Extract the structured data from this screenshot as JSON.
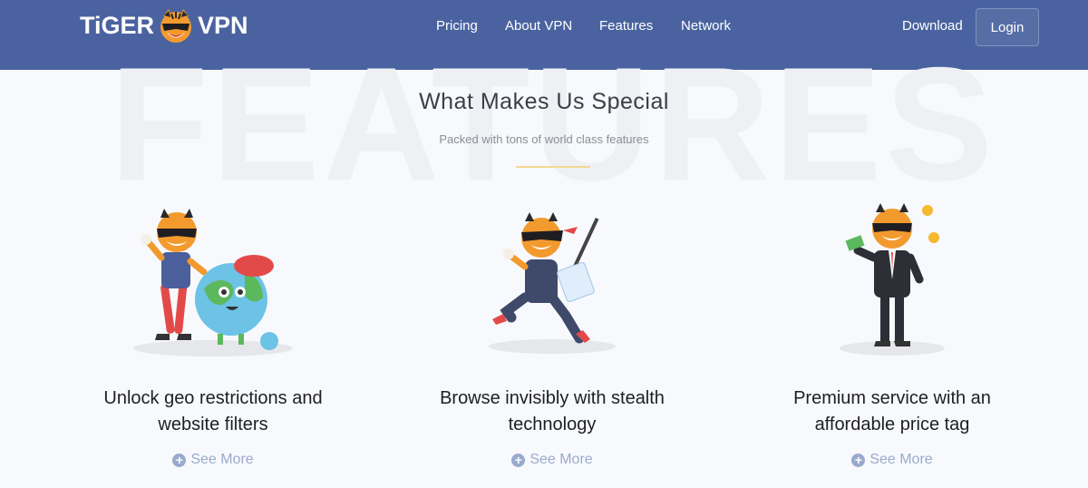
{
  "brand": {
    "name_left": "TiGER",
    "name_right": "VPN"
  },
  "nav": {
    "links": [
      "Pricing",
      "About VPN",
      "Features",
      "Network"
    ],
    "download": "Download",
    "login": "Login"
  },
  "section": {
    "watermark": "FEATURES",
    "title": "What Makes Us Special",
    "subtitle": "Packed with tons of world class features"
  },
  "features": [
    {
      "text_line1": "Unlock geo restrictions and",
      "text_line2": "website filters",
      "link": "See More",
      "illustration": "tiger-with-globe"
    },
    {
      "text_line1": "Browse invisibly with stealth",
      "text_line2": "technology",
      "link": "See More",
      "illustration": "ninja-tiger"
    },
    {
      "text_line1": "Premium service with an",
      "text_line2": "affordable price tag",
      "link": "See More",
      "illustration": "businessman-tiger-with-money"
    }
  ],
  "colors": {
    "nav_bg": "#4a63a0",
    "accent_divider": "#f2d892",
    "link": "#9aaacd",
    "page_bg": "#f8f9fc"
  }
}
